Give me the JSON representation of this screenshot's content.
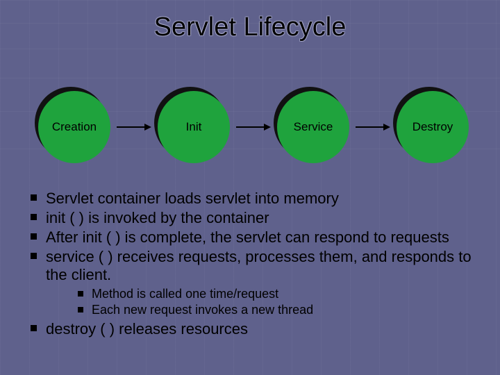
{
  "title": "Servlet Lifecycle",
  "stages": [
    {
      "label": "Creation"
    },
    {
      "label": "Init"
    },
    {
      "label": "Service"
    },
    {
      "label": "Destroy"
    }
  ],
  "bullets": {
    "b1": "Servlet container loads servlet into memory",
    "b2": "init ( ) is invoked by the container",
    "b3": "After init (  ) is complete, the servlet can respond to requests",
    "b4": "service ( ) receives requests, processes them, and responds to the client.",
    "b4_sub1": "Method is called one time/request",
    "b4_sub2": "Each new request invokes a new thread",
    "b5": "destroy ( ) releases resources"
  },
  "colors": {
    "background": "#5f618c",
    "node": "#1fa33d"
  }
}
